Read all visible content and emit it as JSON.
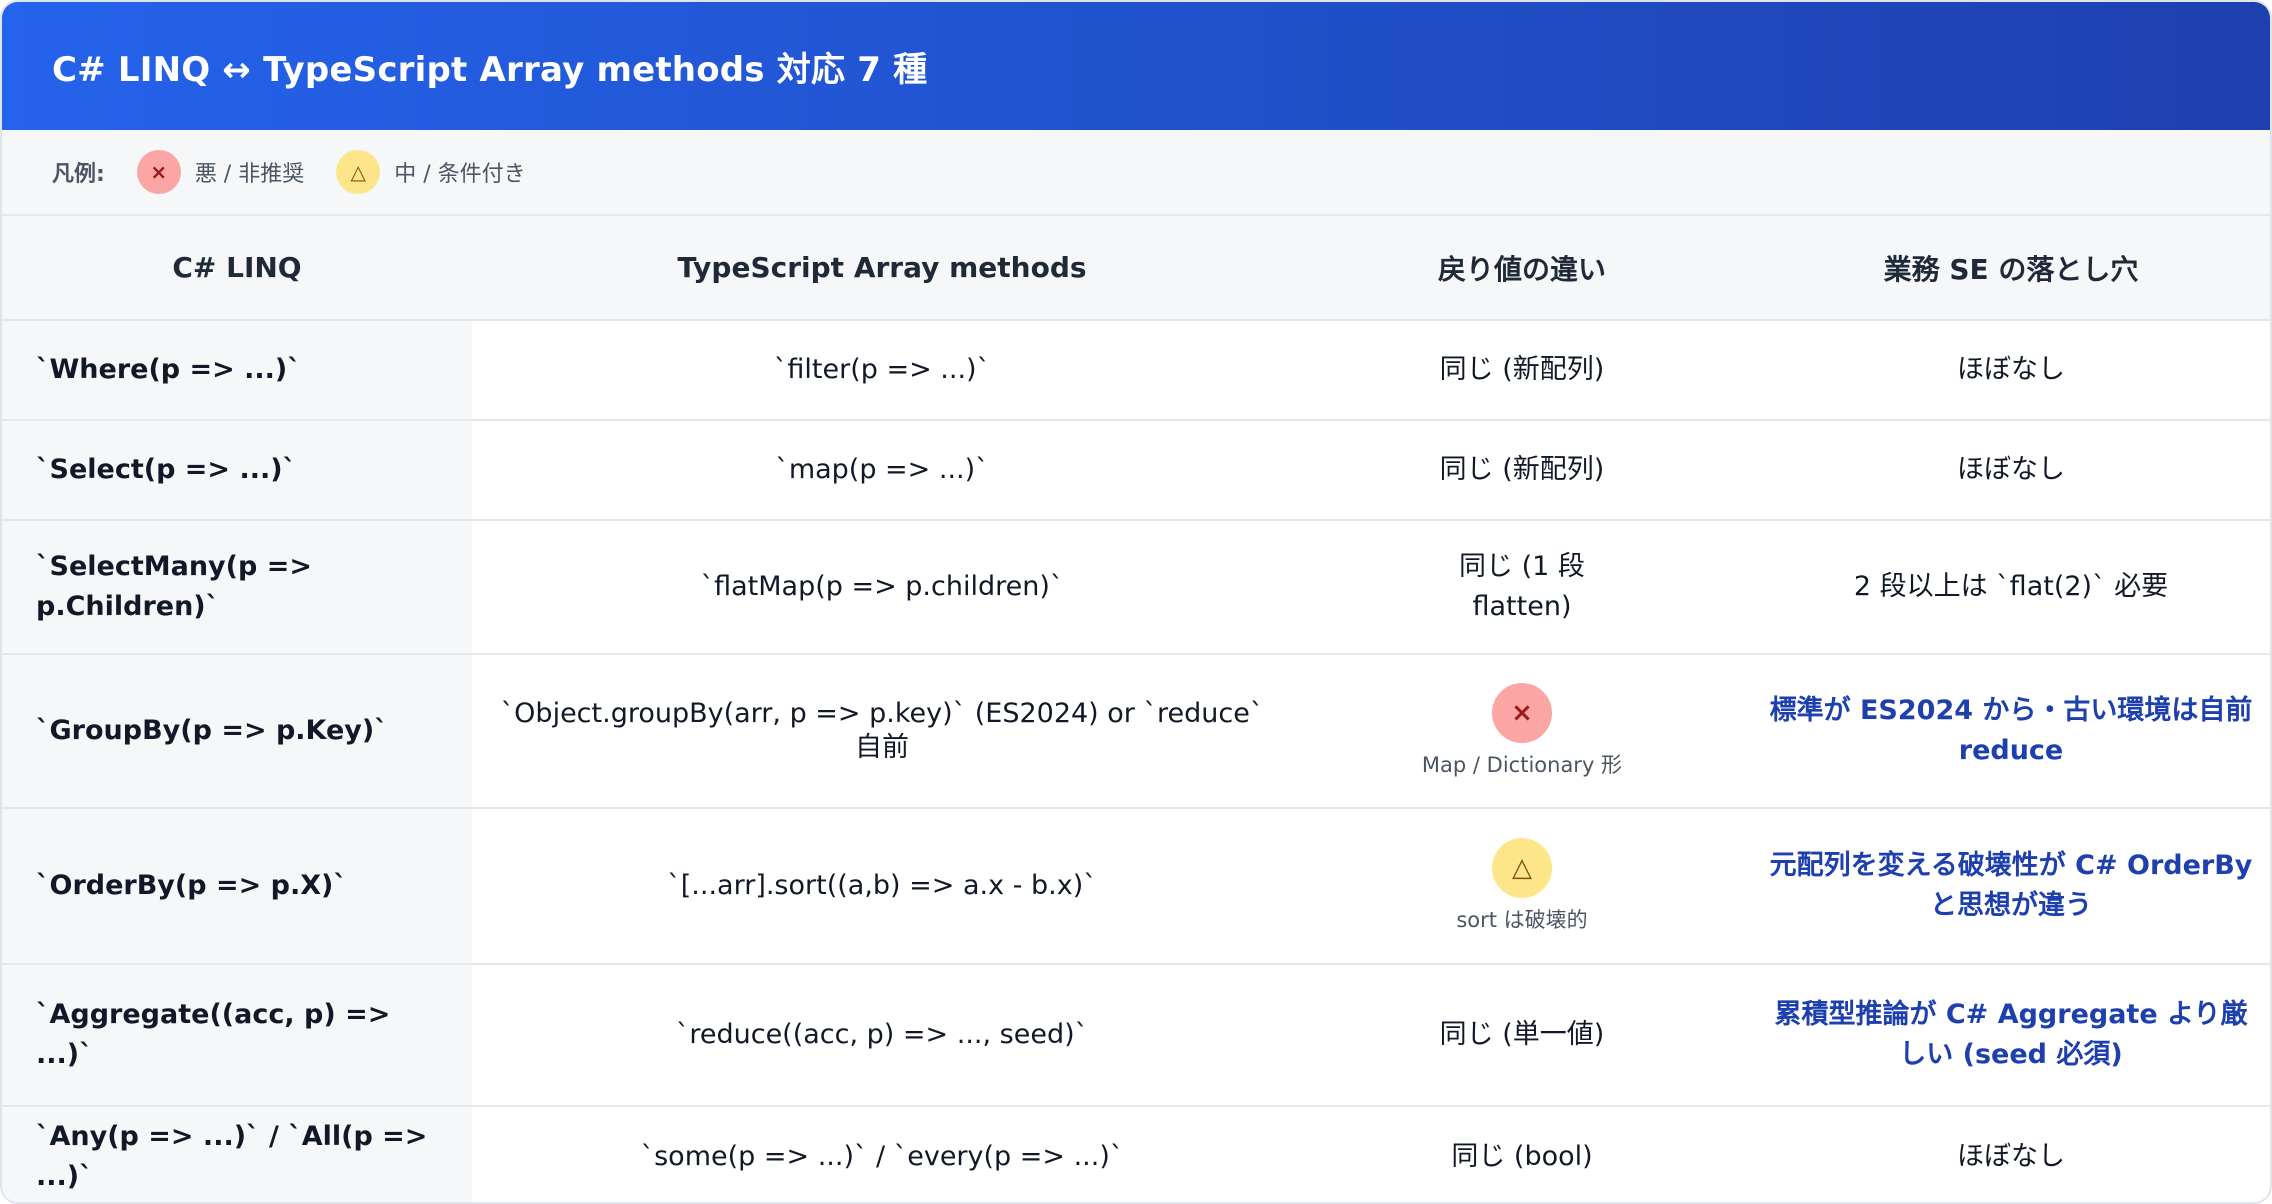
{
  "header": {
    "title": "C# LINQ ↔ TypeScript Array methods 対応 7 種"
  },
  "legend": {
    "label": "凡例:",
    "items": [
      {
        "symbol": "×",
        "text": "悪 / 非推奨"
      },
      {
        "symbol": "△",
        "text": "中 / 条件付き"
      }
    ]
  },
  "table": {
    "columns": [
      "C# LINQ",
      "TypeScript Array methods",
      "戻り値の違い",
      "業務 SE の落とし穴"
    ],
    "rows": [
      {
        "linq": "`Where(p => ...)`",
        "ts": "`filter(p => ...)`",
        "ret": "同じ (新配列)",
        "pitfall": "ほぼなし"
      },
      {
        "linq": "`Select(p => ...)`",
        "ts": "`map(p => ...)`",
        "ret": "同じ (新配列)",
        "pitfall": "ほぼなし"
      },
      {
        "linq": "`SelectMany(p => p.Children)`",
        "ts": "`flatMap(p => p.children)`",
        "ret": "同じ (1 段 flatten)",
        "pitfall": "2 段以上は `flat(2)` 必要"
      },
      {
        "linq": "`GroupBy(p => p.Key)`",
        "ts": "`Object.groupBy(arr, p => p.key)` (ES2024) or `reduce` 自前",
        "ret_badge": "×",
        "ret": "Map / Dictionary 形",
        "pitfall": "標準が ES2024 から・古い環境は自前 reduce"
      },
      {
        "linq": "`OrderBy(p => p.X)`",
        "ts": "`[...arr].sort((a,b) => a.x - b.x)`",
        "ret_badge": "△",
        "ret": "sort は破壊的",
        "pitfall": "元配列を変える破壊性が C# OrderBy と思想が違う"
      },
      {
        "linq": "`Aggregate((acc, p) => ...)`",
        "ts": "`reduce((acc, p) => ..., seed)`",
        "ret": "同じ (単一値)",
        "pitfall": "累積型推論が C# Aggregate より厳しい (seed 必須)"
      },
      {
        "linq": "`Any(p => ...)` / `All(p => ...)`",
        "ts": "`some(p => ...)` / `every(p => ...)`",
        "ret": "同じ (bool)",
        "pitfall": "ほぼなし"
      }
    ]
  }
}
